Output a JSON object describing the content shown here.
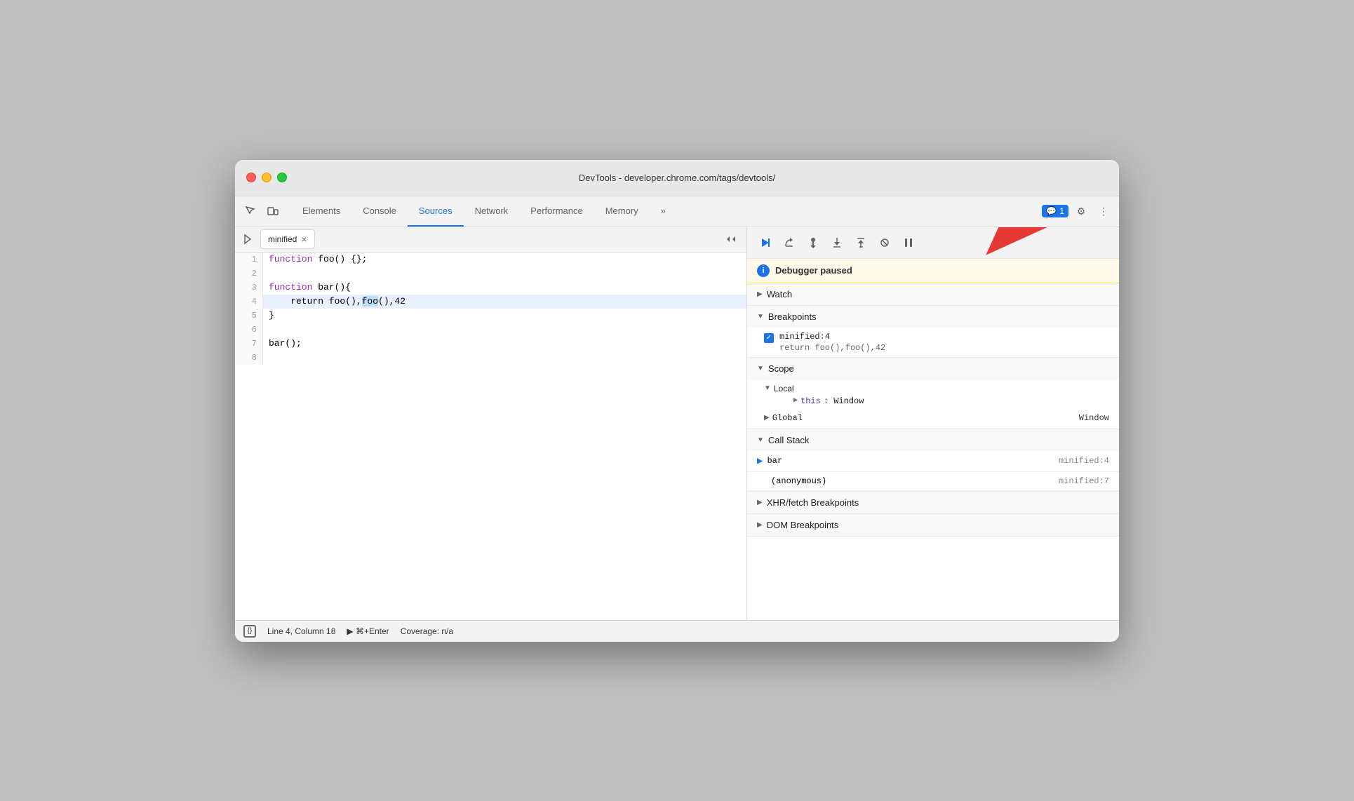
{
  "window": {
    "title": "DevTools - developer.chrome.com/tags/devtools/"
  },
  "toolbar": {
    "tabs": [
      {
        "label": "Elements",
        "active": false
      },
      {
        "label": "Console",
        "active": false
      },
      {
        "label": "Sources",
        "active": true
      },
      {
        "label": "Network",
        "active": false
      },
      {
        "label": "Performance",
        "active": false
      },
      {
        "label": "Memory",
        "active": false
      },
      {
        "label": "»",
        "active": false
      }
    ],
    "more_label": "»",
    "badge_count": "1",
    "badge_icon": "💬"
  },
  "file_tab": {
    "name": "minified",
    "close": "×"
  },
  "code": {
    "lines": [
      {
        "num": "1",
        "content": "function foo() {};",
        "highlighted": false
      },
      {
        "num": "2",
        "content": "",
        "highlighted": false
      },
      {
        "num": "3",
        "content": "function bar(){",
        "highlighted": false
      },
      {
        "num": "4",
        "content": "    return foo(),foo(),42",
        "highlighted": true
      },
      {
        "num": "5",
        "content": "}",
        "highlighted": false
      },
      {
        "num": "6",
        "content": "",
        "highlighted": false
      },
      {
        "num": "7",
        "content": "bar();",
        "highlighted": false
      },
      {
        "num": "8",
        "content": "",
        "highlighted": false
      }
    ]
  },
  "debug": {
    "paused_message": "Debugger paused",
    "sections": {
      "watch": {
        "label": "Watch",
        "expanded": false
      },
      "breakpoints": {
        "label": "Breakpoints",
        "expanded": true,
        "items": [
          {
            "location": "minified:4",
            "source": "return foo(),foo(),42"
          }
        ]
      },
      "scope": {
        "label": "Scope",
        "expanded": true,
        "local": {
          "label": "Local",
          "properties": [
            {
              "key": "this",
              "value": "Window"
            }
          ]
        },
        "global": {
          "label": "Global",
          "value": "Window"
        }
      },
      "callstack": {
        "label": "Call Stack",
        "expanded": true,
        "frames": [
          {
            "name": "bar",
            "location": "minified:4",
            "current": true
          },
          {
            "name": "(anonymous)",
            "location": "minified:7",
            "current": false
          }
        ]
      },
      "xhr_breakpoints": {
        "label": "XHR/fetch Breakpoints",
        "expanded": false
      },
      "dom_breakpoints": {
        "label": "DOM Breakpoints",
        "expanded": false
      }
    }
  },
  "status_bar": {
    "icon": "{}",
    "position": "Line 4, Column 18",
    "run_label": "⌘+Enter",
    "run_prefix": "▶",
    "coverage": "Coverage: n/a"
  }
}
